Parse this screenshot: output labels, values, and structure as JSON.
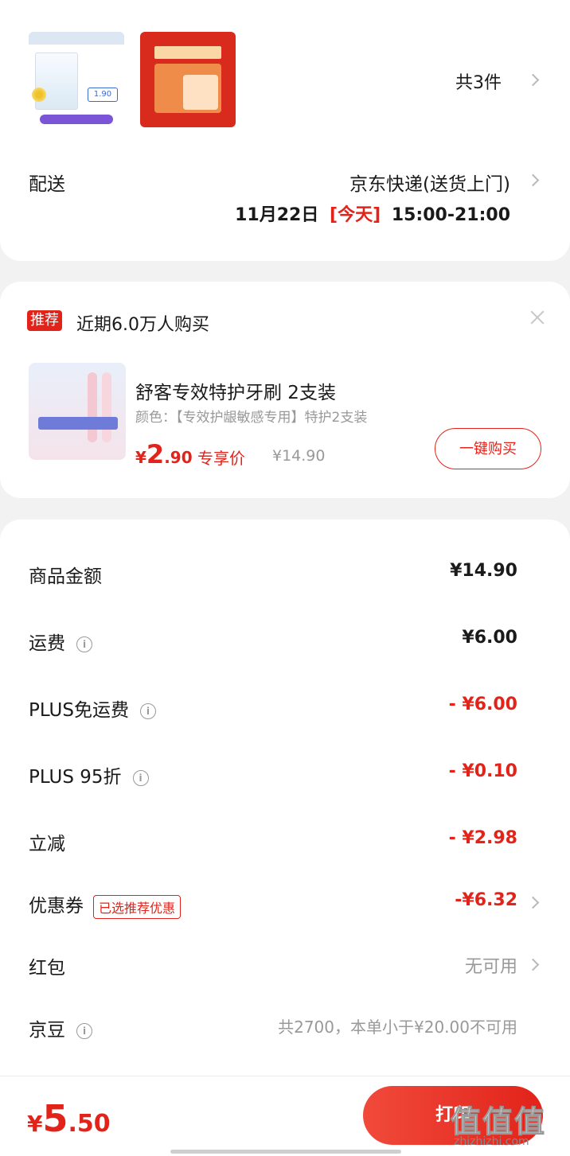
{
  "shipment": {
    "count_label": "共3件",
    "delivery_label": "配送",
    "delivery_method": "京东快递(送货上门)",
    "delivery_date": "11月22日",
    "delivery_today": "[今天]",
    "delivery_time": "15:00-21:00",
    "thumb1_price": "1.90"
  },
  "recommend": {
    "tag": "推荐",
    "headline": "近期6.0万人购买",
    "product_title": "舒客专效特护牙刷 2支装",
    "product_spec": "颜色：【专效护龈敏感专用】特护2支装",
    "price_symbol": "¥",
    "price_int": "2",
    "price_dec": ".90",
    "price_tag": "专享价",
    "original_price": "¥14.90",
    "buy_button": "一键购买"
  },
  "summary": {
    "rows": [
      {
        "label": "商品金额",
        "value": "¥14.90"
      },
      {
        "label": "运费",
        "value": "¥6.00"
      },
      {
        "label": "PLUS免运费",
        "value": "- ¥6.00"
      },
      {
        "label": "PLUS 95折",
        "value": "- ¥0.10"
      },
      {
        "label": "立减",
        "value": "- ¥2.98"
      },
      {
        "label": "优惠券",
        "value": "-¥6.32",
        "tag": "已选推荐优惠"
      },
      {
        "label": "红包",
        "value": "无可用"
      },
      {
        "label": "京豆",
        "value": "共2700，本单小于¥20.00不可用"
      }
    ]
  },
  "footer": {
    "total_symbol": "¥",
    "total_int": "5",
    "total_dec": ".50",
    "submit_label": "打印",
    "watermark": "值值值",
    "watermark_url": "zhizhizhi.com"
  },
  "colors": {
    "accent": "#e2231a",
    "background": "#f2f2f2"
  }
}
